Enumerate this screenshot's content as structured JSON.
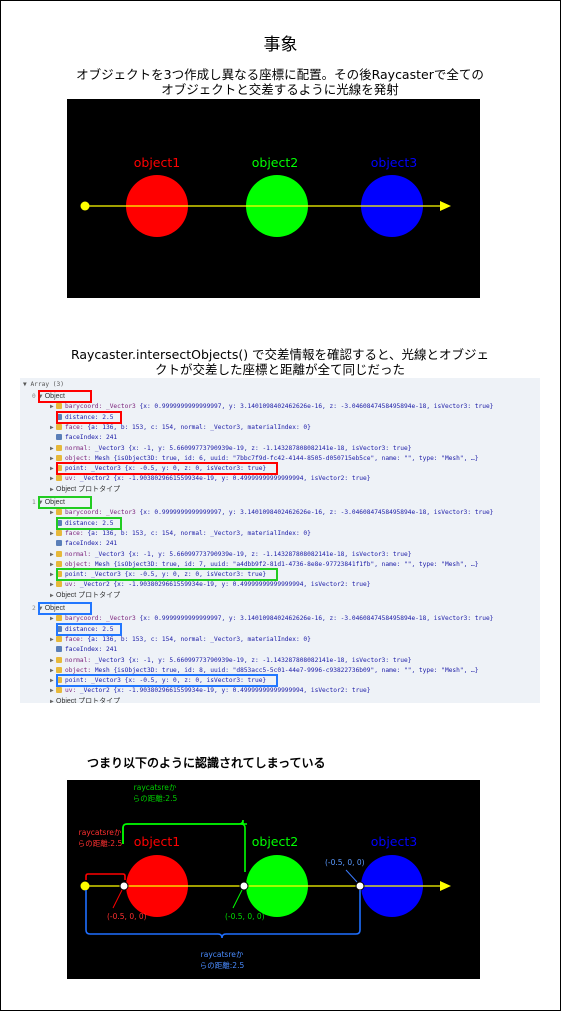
{
  "title": "事象",
  "caption1": [
    "オブジェクトを3つ作成し異なる座標に配置。その後Raycasterで全ての",
    "オブジェクトと交差するように光線を発射"
  ],
  "caption2": [
    "Raycaster.intersectObjects() で交差情報を確認すると、光線とオブジェ",
    "クトが交差した座標と距離が全て同じだった"
  ],
  "caption3": "つまり以下のように認識されてしまっている",
  "objects": [
    {
      "label": "object1",
      "color": "#ff0000"
    },
    {
      "label": "object2",
      "color": "#00ff00"
    },
    {
      "label": "object3",
      "color": "#0000ff"
    }
  ],
  "annotations": {
    "dist_green": [
      "raycatsreか",
      "らの距離:2.5"
    ],
    "dist_red": [
      "raycatsreか",
      "らの距離:2.5"
    ],
    "dist_blue": [
      "raycatsreか",
      "らの距離:2.5"
    ],
    "coord_red": "(-0.5, 0, 0)",
    "coord_green": "(-0.5, 0, 0)",
    "coord_blue": "(-0.5, 0, 0)"
  },
  "console": {
    "header": "▼ Array (3)",
    "entries": [
      {
        "index": "0",
        "object_label": "Object",
        "barycoord": "{x: 0.9999999999999997, y: 3.1401098402462626e-16, z: -3.0460847458495894e-18, isVector3: true}",
        "distance": "distance: 2.5",
        "face": "{a: 136, b: 153, c: 154, normal: _Vector3, materialIndex: 0}",
        "faceIndex": "faceIndex: 241",
        "normal": "_Vector3 {x: -1, y: 5.66099773790939e-19, z: -1.143287808082141e-18, isVector3: true}",
        "object": "Mesh {isObject3D: true, id: 6, uuid: \"7bbc7f9d-fc42-4144-8505-d050715eb5ce\", name: \"\", type: \"Mesh\", …}",
        "point": "point: _Vector3 {x: -0.5, y: 0, z: 0, isVector3: true}",
        "uv": "_Vector2 {x: -1.9038029661559934e-19, y: 0.49999999999999994, isVector2: true}",
        "proto": "Object プロトタイプ"
      },
      {
        "index": "1",
        "object_label": "Object",
        "barycoord": "{x: 0.9999999999999997, y: 3.1401098402462626e-16, z: -3.0460847458495894e-18, isVector3: true}",
        "distance": "distance: 2.5",
        "face": "{a: 136, b: 153, c: 154, normal: _Vector3, materialIndex: 0}",
        "faceIndex": "faceIndex: 241",
        "normal": "_Vector3 {x: -1, y: 5.66099773790939e-19, z: -1.143287808082141e-18, isVector3: true}",
        "object": "Mesh {isObject3D: true, id: 7, uuid: \"a4dbb9f2-81d1-4736-8e8e-97723841f1fb\", name: \"\", type: \"Mesh\", …}",
        "point": "point: _Vector3 {x: -0.5, y: 0, z: 0, isVector3: true}",
        "uv": "_Vector2 {x: -1.9038029661559934e-19, y: 0.49999999999999994, isVector2: true}",
        "proto": "Object プロトタイプ"
      },
      {
        "index": "2",
        "object_label": "Object",
        "barycoord": "{x: 0.9999999999999997, y: 3.1401098402462626e-16, z: -3.0460847458495894e-18, isVector3: true}",
        "distance": "distance: 2.5",
        "face": "{a: 136, b: 153, c: 154, normal: _Vector3, materialIndex: 0}",
        "faceIndex": "faceIndex: 241",
        "normal": "_Vector3 {x: -1, y: 5.66099773790939e-19, z: -1.143287808082141e-18, isVector3: true}",
        "object": "Mesh {isObject3D: true, id: 8, uuid: \"d853acc5-5c01-44e7-9996-c93822736b09\", name: \"\", type: \"Mesh\", …}",
        "point": "point: _Vector3 {x: -0.5, y: 0, z: 0, isVector3: true}",
        "uv": "_Vector2 {x: -1.9038029661559934e-19, y: 0.49999999999999994, isVector2: true}",
        "proto": "Object プロトタイプ"
      }
    ]
  }
}
